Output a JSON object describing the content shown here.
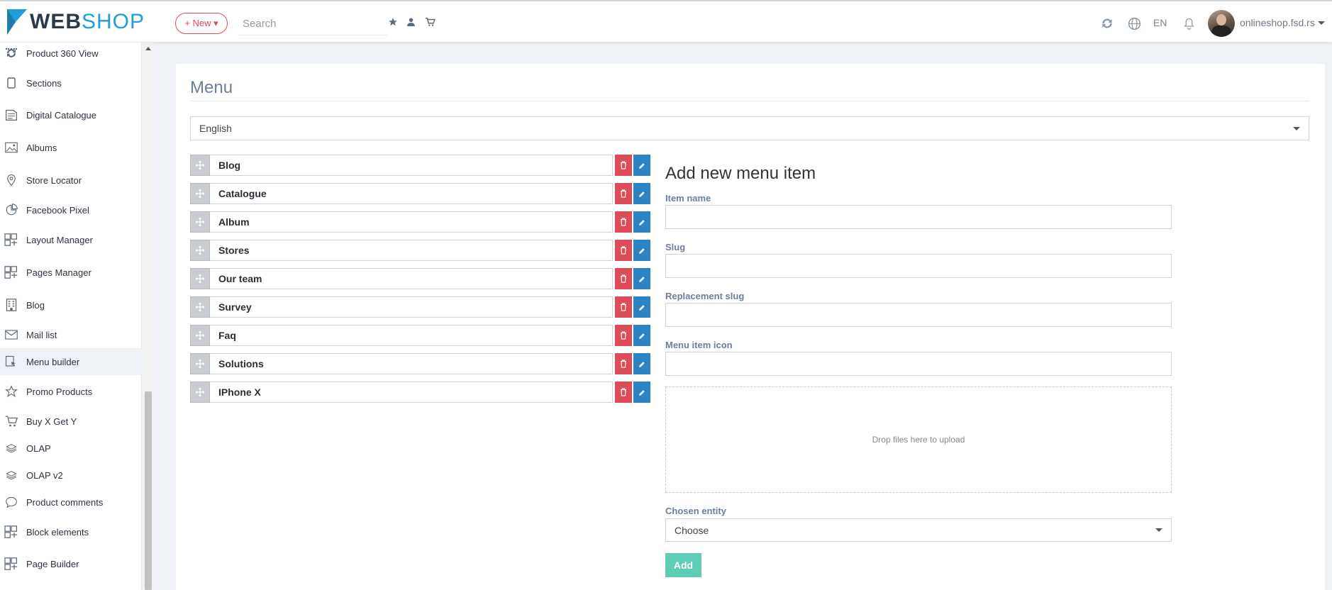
{
  "header": {
    "logo": {
      "part1": "WEB",
      "part2": "SHOP"
    },
    "new_button": "+ New ▾",
    "search_placeholder": "Search",
    "language": "EN",
    "user": "onlineshop.fsd.rs"
  },
  "sidebar": {
    "items": [
      {
        "label": "Product 360 View",
        "icon": "rotate-icon"
      },
      {
        "label": "Sections",
        "icon": "tablet-icon"
      },
      {
        "label": "Digital Catalogue",
        "icon": "catalogue-icon"
      },
      {
        "label": "Albums",
        "icon": "image-icon"
      },
      {
        "label": "Store Locator",
        "icon": "map-pin-icon"
      },
      {
        "label": "Facebook Pixel",
        "icon": "pie-chart-icon"
      },
      {
        "label": "Layout Manager",
        "icon": "layout-icon"
      },
      {
        "label": "Pages Manager",
        "icon": "layout-icon"
      },
      {
        "label": "Blog",
        "icon": "building-icon"
      },
      {
        "label": "Mail list",
        "icon": "mail-icon"
      },
      {
        "label": "Menu builder",
        "icon": "menu-builder-icon",
        "active": true
      },
      {
        "label": "Promo Products",
        "icon": "star-icon"
      },
      {
        "label": "Buy X Get Y",
        "icon": "cart-icon"
      },
      {
        "label": "OLAP",
        "icon": "layers-icon"
      },
      {
        "label": "OLAP v2",
        "icon": "layers-icon"
      },
      {
        "label": "Product comments",
        "icon": "comment-icon"
      },
      {
        "label": "Block elements",
        "icon": "layout-icon"
      },
      {
        "label": "Page Builder",
        "icon": "layout-icon"
      }
    ]
  },
  "main": {
    "title": "Menu",
    "language_select": "English",
    "menu_items": [
      "Blog",
      "Catalogue",
      "Album",
      "Stores",
      "Our team",
      "Survey",
      "Faq",
      "Solutions",
      "IPhone X"
    ],
    "form": {
      "title": "Add new menu item",
      "item_name_label": "Item name",
      "slug_label": "Slug",
      "replacement_slug_label": "Replacement slug",
      "menu_item_icon_label": "Menu item icon",
      "dropzone_text": "Drop files here to upload",
      "chosen_entity_label": "Chosen entity",
      "chosen_entity_value": "Choose",
      "add_button": "Add"
    }
  },
  "colors": {
    "accent_blue": "#1e9fd8",
    "danger": "#e04b58",
    "edit": "#2d83c4",
    "add": "#5fcdb6",
    "label": "#6b7f99"
  }
}
